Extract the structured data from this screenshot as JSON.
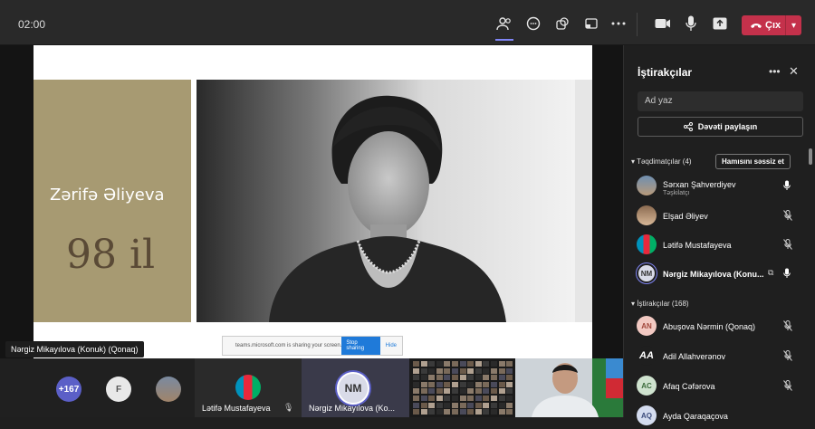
{
  "topbar": {
    "timer": "02:00",
    "leave_label": "Çıx",
    "colors": {
      "accent": "#7f85f5",
      "leave": "#c4314b"
    },
    "icons": [
      "people-icon",
      "chat-icon",
      "reactions-icon",
      "share-tray-icon",
      "more-icon",
      "camera-icon",
      "mic-icon",
      "share-screen-icon",
      "phone-icon",
      "chevron-down-icon"
    ]
  },
  "slide": {
    "name": "Zərifə Əliyeva",
    "years": "98 il"
  },
  "sharing_bar": {
    "message": "teams.microsoft.com is sharing your screen.",
    "stop_label": "Stop sharing",
    "hide_label": "Hide"
  },
  "presenter_tag": "Nərgiz Mikayılova (Konuk) (Qonaq)",
  "gallery": {
    "overflow_count": "+167",
    "f_initial": "F",
    "tiles": [
      {
        "caption": "Lətifə Mustafayeva"
      },
      {
        "initials": "NM",
        "caption": "Nərgiz Mikayılova (Ko..."
      }
    ]
  },
  "panel": {
    "title": "İştirakçılar",
    "search_placeholder": "Ad yaz",
    "share_invite_label": "Dəvəti paylaşın",
    "presenters_header": "Təqdimatçılar (4)",
    "mute_all_label": "Hamısını səssiz et",
    "attendees_header": "İştirakçılar (168)",
    "presenters": [
      {
        "name": "Sərxan Şahverdiyev",
        "role": "Təşkilatçı",
        "mic": "on"
      },
      {
        "name": "Elşad Əliyev",
        "mic": "muted"
      },
      {
        "name": "Lətifə Mustafayeva",
        "mic": "muted"
      },
      {
        "initials": "NM",
        "name": "Nərgiz Mikayılova (Konu...",
        "mic": "on"
      }
    ],
    "attendees": [
      {
        "initials": "AN",
        "name": "Abuşova Nərmin (Qonaq)",
        "mic": "muted"
      },
      {
        "initials": "AA",
        "name": "Adil Allahverənov",
        "mic": "muted"
      },
      {
        "initials": "AC",
        "name": "Afaq Cəfərova",
        "mic": "muted"
      },
      {
        "initials": "AQ",
        "name": "Ayda Qaraqaçova",
        "mic": "muted"
      }
    ]
  }
}
